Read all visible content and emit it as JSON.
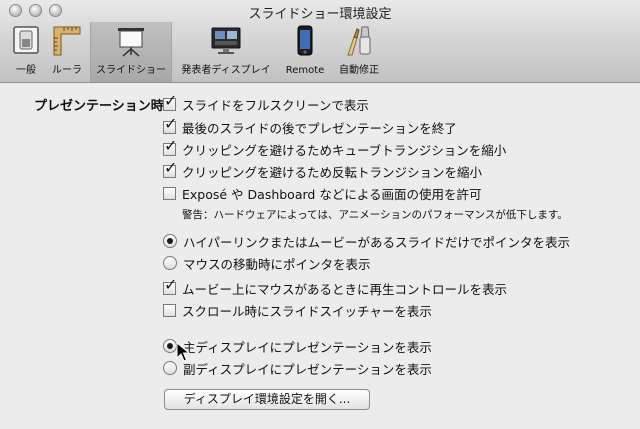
{
  "window": {
    "title": "スライドショー環境設定"
  },
  "toolbar": {
    "items": [
      {
        "label": "一般",
        "icon": "switch-icon"
      },
      {
        "label": "ルーラ",
        "icon": "ruler-icon"
      },
      {
        "label": "スライドショー",
        "icon": "projector-screen-icon",
        "selected": true
      },
      {
        "label": "発表者ディスプレイ",
        "icon": "presenter-display-icon"
      },
      {
        "label": "Remote",
        "icon": "iphone-icon"
      },
      {
        "label": "自動修正",
        "icon": "autocorrect-icon"
      }
    ]
  },
  "presentation": {
    "heading": "プレゼンテーション時：",
    "options": [
      {
        "label": "スライドをフルスクリーンで表示",
        "checked": true
      },
      {
        "label": "最後のスライドの後でプレゼンテーションを終了",
        "checked": true
      },
      {
        "label": "クリッピングを避けるためキューブトランジションを縮小",
        "checked": true
      },
      {
        "label": "クリッピングを避けるため反転トランジションを縮小",
        "checked": true
      },
      {
        "label": "Exposé や Dashboard などによる画面の使用を許可",
        "checked": false
      }
    ],
    "warning": "警告：ハードウェアによっては、アニメーションのパフォーマンスが低下します。",
    "pointer_options": [
      {
        "label": "ハイパーリンクまたはムービーがあるスライドだけでポインタを表示",
        "selected": true
      },
      {
        "label": "マウスの移動時にポインタを表示",
        "selected": false
      }
    ],
    "movie_options": [
      {
        "label": "ムービー上にマウスがあるときに再生コントロールを表示",
        "checked": true
      },
      {
        "label": "スクロール時にスライドスイッチャーを表示",
        "checked": false
      }
    ],
    "display_options": [
      {
        "label": "主ディスプレイにプレゼンテーションを表示",
        "selected": true
      },
      {
        "label": "副ディスプレイにプレゼンテーションを表示",
        "selected": false
      }
    ],
    "open_display_prefs": "ディスプレイ環境設定を開く..."
  },
  "glyphs": {
    "check": "✓"
  }
}
